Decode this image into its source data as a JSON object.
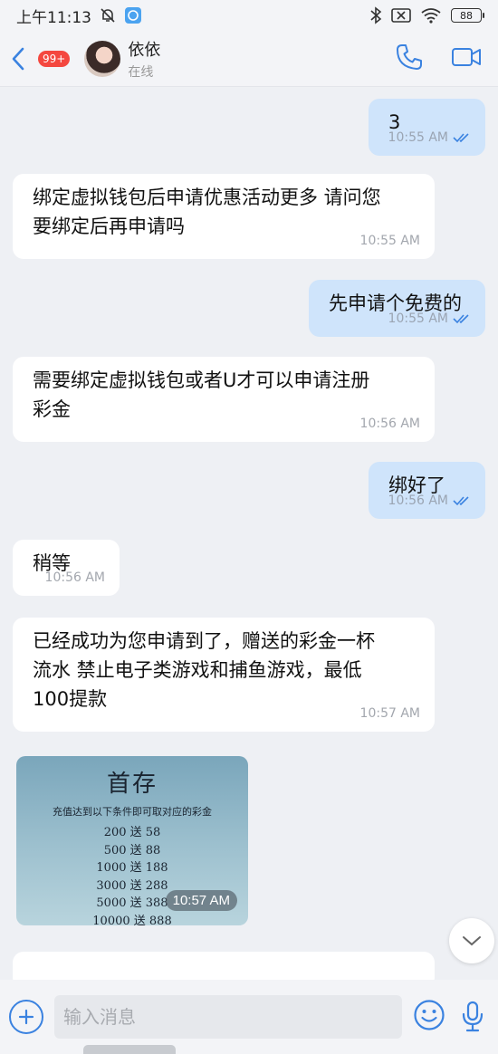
{
  "status_bar": {
    "time": "上午11:13",
    "battery": "88"
  },
  "header": {
    "unread_count": "99+",
    "contact_name": "依依",
    "presence": "在线"
  },
  "messages": [
    {
      "dir": "out",
      "text": "3",
      "time": "10:55 AM"
    },
    {
      "dir": "in",
      "text": "绑定虚拟钱包后申请优惠活动更多 请问您\n要绑定后再申请吗",
      "time": "10:55 AM"
    },
    {
      "dir": "out",
      "text": "先申请个免费的",
      "time": "10:55 AM"
    },
    {
      "dir": "in",
      "text": "需要绑定虚拟钱包或者U才可以申请注册\n彩金",
      "time": "10:56 AM"
    },
    {
      "dir": "out",
      "text": "绑好了",
      "time": "10:56 AM"
    },
    {
      "dir": "in",
      "text": "稍等",
      "time": "10:56 AM"
    },
    {
      "dir": "in",
      "text": "已经成功为您申请到了，赠送的彩金一杯\n流水 禁止电子类游戏和捕鱼游戏，最低\n100提款",
      "time": "10:57 AM"
    }
  ],
  "promo_image": {
    "title": "首存",
    "subtitle": "充值达到以下条件即可取对应的彩金",
    "tiers": [
      "200 送 58",
      "500 送 88",
      "1000 送 188",
      "3000 送 288",
      "5000 送 388",
      "10000 送 888"
    ],
    "time": "10:57 AM"
  },
  "input": {
    "placeholder": "输入消息"
  },
  "colors": {
    "accent": "#3a82e0",
    "outgoing_bubble": "#cfe4fb",
    "badge": "#f4473f"
  }
}
